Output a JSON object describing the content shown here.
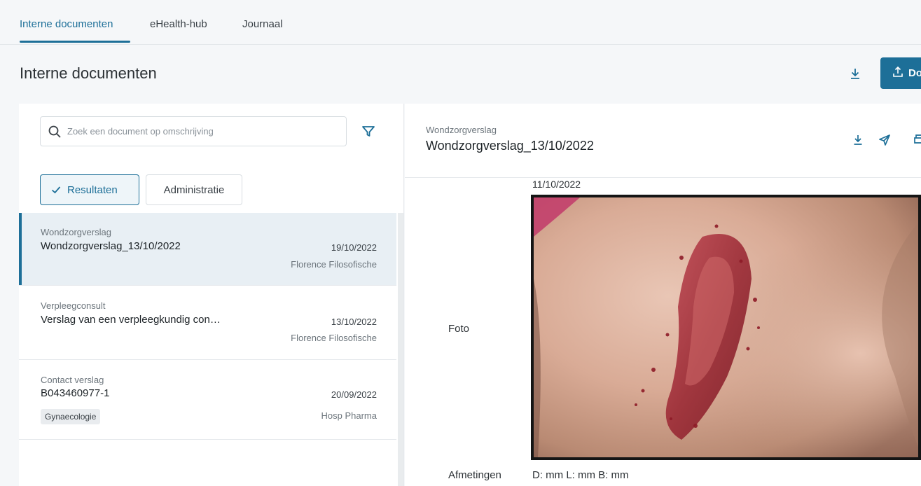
{
  "tabs": [
    {
      "label": "Interne documenten",
      "active": true
    },
    {
      "label": "eHealth-hub",
      "active": false
    },
    {
      "label": "Journaal",
      "active": false
    }
  ],
  "page": {
    "title": "Interne documenten",
    "upload_label": "Do"
  },
  "search": {
    "placeholder": "Zoek een document op omschrijving"
  },
  "filters": {
    "resultaten": "Resultaten",
    "administratie": "Administratie"
  },
  "documents": [
    {
      "category": "Wondzorgverslag",
      "title": "Wondzorgverslag_13/10/2022",
      "date": "19/10/2022",
      "author": "Florence Filosofische",
      "selected": true
    },
    {
      "category": "Verpleegconsult",
      "title": "Verslag van een verpleegkundig con…",
      "date": "13/10/2022",
      "author": "Florence Filosofische",
      "selected": false
    },
    {
      "category": "Contact verslag",
      "title": "B043460977-1",
      "date": "20/09/2022",
      "author": "Hosp Pharma",
      "tag": "Gynaecologie",
      "selected": false
    }
  ],
  "detail": {
    "category": "Wondzorgverslag",
    "title": "Wondzorgverslag_13/10/2022",
    "photo_date": "11/10/2022",
    "photo_label": "Foto",
    "measure_label": "Afmetingen",
    "measure_value": "D: mm L: mm B: mm"
  },
  "icons": {
    "download": "download-icon",
    "upload": "upload-icon",
    "send": "send-icon",
    "print": "print-icon",
    "search": "search-icon",
    "filter": "filter-icon",
    "check": "check-icon"
  },
  "colors": {
    "accent": "#1d6f98",
    "selected_row": "#e8eff4",
    "background": "#f5f7f9"
  }
}
